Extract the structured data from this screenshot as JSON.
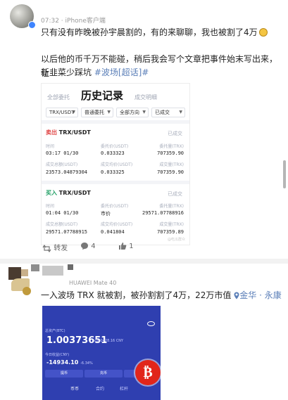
{
  "post1": {
    "meta": "07:32 · iPhone客户端",
    "line1": "只有没有昨晚被孙宇晨割的，有的来聊聊，我也被割了4万",
    "line2": "以后他的币千万不能碰，稍后我会写个文章把事件始末写出来，让",
    "line3_prefix": "新韭菜少踩坑 ",
    "line3_topic": "#波场[超话]#",
    "screenshot": {
      "tabs": [
        "全部委托",
        "历史记录",
        "成交明细"
      ],
      "filters": [
        "TRX/USDT",
        "普通委托",
        "全部方向",
        "已成交"
      ],
      "orders": [
        {
          "side": "卖出",
          "pair": "TRX/USDT",
          "status": "已成交",
          "labels_top": [
            "时间",
            "委托价(USDT)",
            "委托量(TRX)"
          ],
          "values_top": [
            "03:17 01/30",
            "0.033323",
            "707359.90"
          ],
          "labels_bottom": [
            "成交总额(USDT)",
            "成交均价(USDT)",
            "成交量(TRX)"
          ],
          "values_bottom": [
            "23573.04879304",
            "0.033325",
            "707359.90"
          ]
        },
        {
          "side": "买入",
          "pair": "TRX/USDT",
          "status": "已成交",
          "labels_top": [
            "时间",
            "委托价(USDT)",
            "委托量(TRX)"
          ],
          "values_top": [
            "01:04 01/30",
            "市价",
            "29571.07788916"
          ],
          "labels_bottom": [
            "成交总额(USDT)",
            "成交均价(USDT)",
            "成交量(TRX)"
          ],
          "values_bottom": [
            "29571.07788915",
            "0.041804",
            "707359.89"
          ]
        }
      ],
      "watermark": "@吃瓜群众"
    },
    "actions": {
      "repost": "转发",
      "comments": "4",
      "likes": "1"
    }
  },
  "post2": {
    "meta": "HUAWEI Mate 40",
    "text": "一入波场 TRX 就被割，被孙割割了4万，22万市值",
    "location": "金华 · 永康",
    "phone": {
      "label1": "总资产(BTC)",
      "balance": "1.00373651",
      "fiat": "≈220428.16 CNY",
      "label2": "今日收益(CNY)",
      "pnl": "-14934.10",
      "pnl_pct": "-6.34%",
      "buttons": [
        "提币",
        "充币",
        "划转"
      ],
      "nav": [
        "币币",
        "合约",
        "杠杆"
      ]
    },
    "colors": {
      "phone_bg": "#2f3fb0",
      "btc_badge": "#e1251b"
    }
  }
}
